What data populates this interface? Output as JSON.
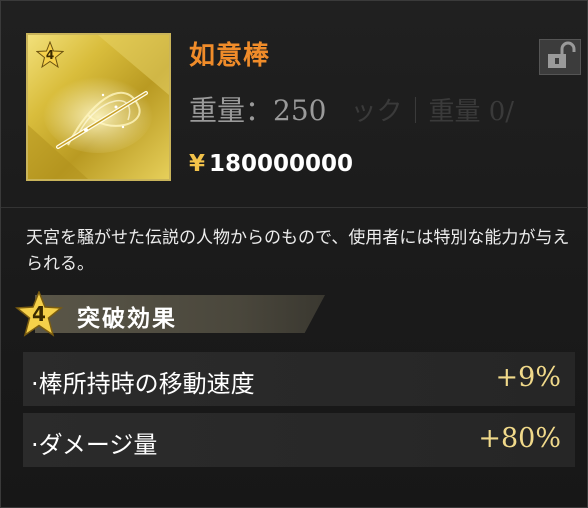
{
  "item": {
    "name": "如意棒",
    "star_level": "4",
    "weight_text": "重量：250",
    "weight_ghost_text": "ック｜重量 0/",
    "price_symbol": "¥",
    "price_value": "180000000",
    "lock_icon": "padlock-open-icon"
  },
  "description": "天宮を騒がせた伝説の人物からのもので、使用者には特別な能力が与えられる。",
  "effect": {
    "star_level": "4",
    "title": "突破効果",
    "stats": [
      {
        "label": "·棒所持時の移動速度",
        "value": "+9%"
      },
      {
        "label": "·ダメージ量",
        "value": "+80%"
      }
    ]
  },
  "colors": {
    "name": "#f08c2a",
    "value": "#f0d98a",
    "gold": "#d9bd3c"
  }
}
